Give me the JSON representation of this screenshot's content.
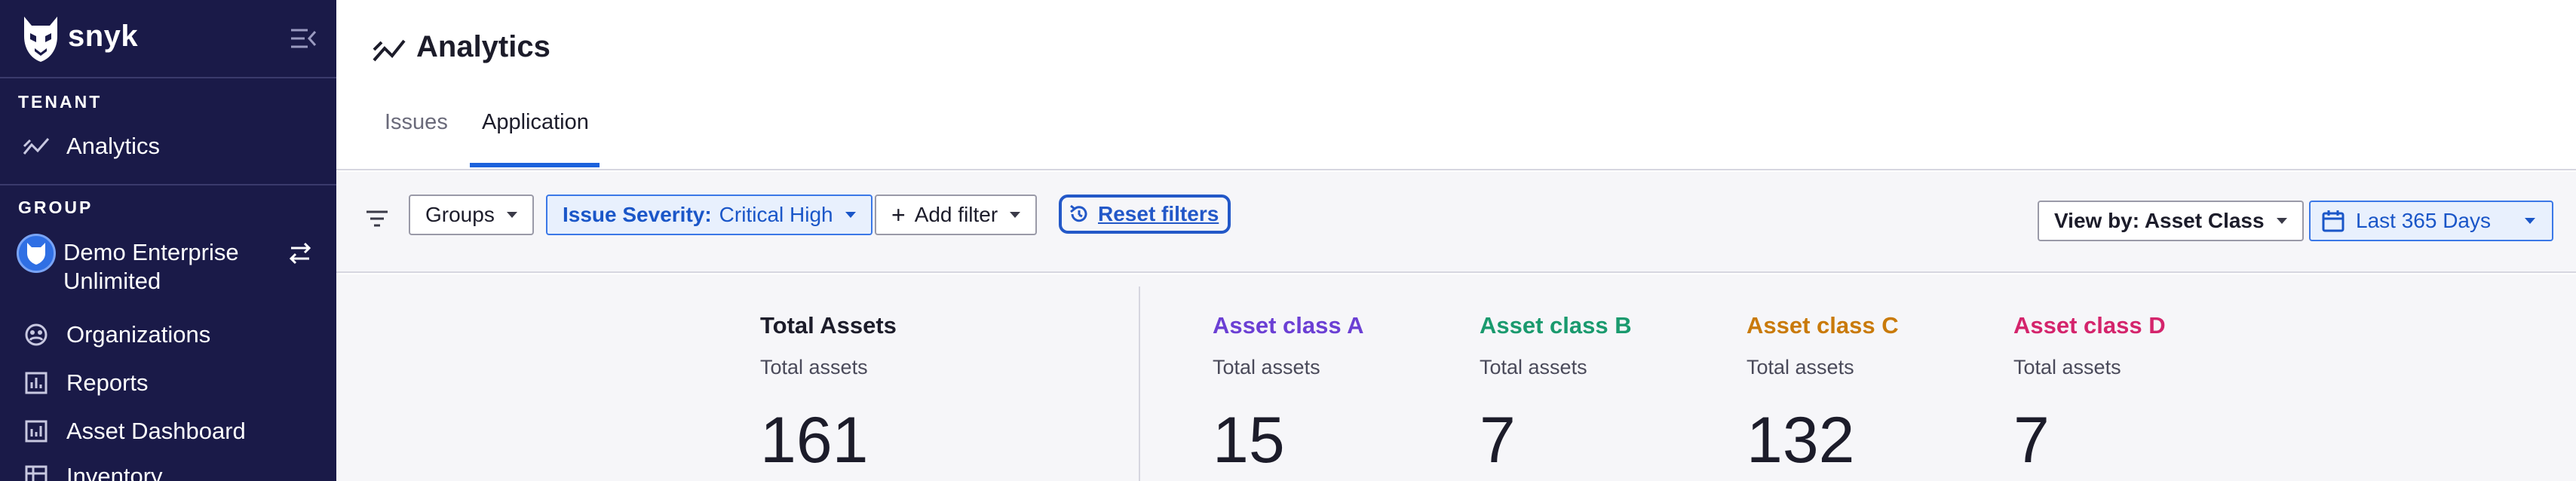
{
  "sidebar": {
    "brand": "snyk",
    "tenant_heading": "TENANT",
    "tenant_items": [
      {
        "label": "Analytics",
        "icon": "analytics-icon"
      }
    ],
    "group_heading": "GROUP",
    "group": {
      "name": "Demo Enterprise Unlimited",
      "switch_icon": "switch-icon"
    },
    "group_items": [
      {
        "label": "Organizations",
        "icon": "organizations-icon"
      },
      {
        "label": "Reports",
        "icon": "reports-icon"
      },
      {
        "label": "Asset Dashboard",
        "icon": "dashboard-icon"
      },
      {
        "label": "Inventory",
        "icon": "inventory-icon"
      }
    ]
  },
  "header": {
    "title": "Analytics",
    "tabs": [
      {
        "label": "Issues",
        "active": false
      },
      {
        "label": "Application",
        "active": true
      }
    ]
  },
  "filters": {
    "groups_label": "Groups",
    "severity_key": "Issue Severity:",
    "severity_value": "Critical High",
    "add_filter_label": "Add filter",
    "reset_label": "Reset filters",
    "view_by_label": "View by: Asset Class",
    "date_range_label": "Last 365 Days"
  },
  "metrics": {
    "total": {
      "title": "Total Assets",
      "subtitle": "Total assets",
      "value": "161"
    },
    "classes": [
      {
        "title": "Asset class A",
        "subtitle": "Total assets",
        "value": "15",
        "color": "#6b3fd4"
      },
      {
        "title": "Asset class B",
        "subtitle": "Total assets",
        "value": "7",
        "color": "#1a9a6e"
      },
      {
        "title": "Asset class C",
        "subtitle": "Total assets",
        "value": "132",
        "color": "#c97a0a"
      },
      {
        "title": "Asset class D",
        "subtitle": "Total assets",
        "value": "7",
        "color": "#d4246c"
      }
    ]
  },
  "colors": {
    "sidebar_bg": "#1a1a48",
    "accent": "#1c62dc"
  }
}
